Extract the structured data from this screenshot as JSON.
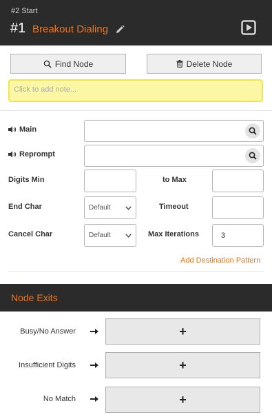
{
  "header": {
    "subtitle": "#2 Start",
    "node_number": "#1",
    "node_name": "Breakout Dialing"
  },
  "toolbar": {
    "find_label": "Find Node",
    "delete_label": "Delete Node"
  },
  "note": {
    "placeholder": "Click to add note..."
  },
  "form": {
    "main_label": "Main",
    "reprompt_label": "Reprompt",
    "digits_min_label": "Digits Min",
    "to_max_label": "to Max",
    "end_char_label": "End Char",
    "end_char_value": "Default",
    "timeout_label": "Timeout",
    "cancel_char_label": "Cancel Char",
    "cancel_char_value": "Default",
    "max_iterations_label": "Max Iterations",
    "max_iterations_value": "3",
    "add_destination_label": "Add Destination Pattern"
  },
  "exits": {
    "title": "Node Exits",
    "items": [
      {
        "label": "Busy/No Answer",
        "button": "+"
      },
      {
        "label": "Insufficient Digits",
        "button": "+"
      },
      {
        "label": "No Match",
        "button": "+"
      }
    ]
  }
}
